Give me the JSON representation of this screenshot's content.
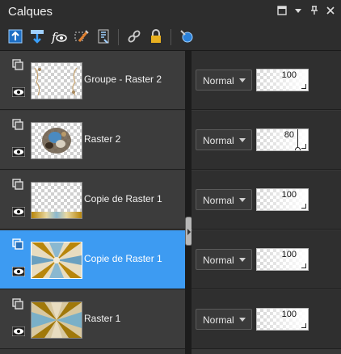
{
  "panel": {
    "title": "Calques"
  },
  "window_controls": [
    {
      "name": "restore-icon",
      "glyph": "▢"
    },
    {
      "name": "menu-arrow-icon",
      "glyph": "▾"
    },
    {
      "name": "pin-icon",
      "glyph": "⊥"
    },
    {
      "name": "close-icon",
      "glyph": "✕"
    }
  ],
  "toolbar": [
    {
      "name": "new-raster-layer-icon",
      "color": "#3aa0ff"
    },
    {
      "name": "new-vector-layer-icon",
      "color": "#3aa0ff"
    },
    {
      "name": "new-adjustment-layer-icon",
      "color": "#ffffff"
    },
    {
      "name": "edit-selection-icon",
      "color": "#e08030"
    },
    {
      "name": "layer-properties-icon",
      "color": "#9fd0ff"
    },
    {
      "name": "link-icon",
      "color": "#cccccc"
    },
    {
      "name": "lock-icon",
      "color": "#e8b020"
    },
    {
      "name": "delete-layer-icon",
      "color": "#3aa0ff"
    }
  ],
  "layers": [
    {
      "name": "Groupe - Raster 2",
      "blend": "Normal",
      "opacity": "100",
      "opacity_fraction": 1.0,
      "selected": false,
      "thumb": "transparent-ornament"
    },
    {
      "name": "Raster 2",
      "blend": "Normal",
      "opacity": "80",
      "opacity_fraction": 0.8,
      "selected": false,
      "thumb": "ornament"
    },
    {
      "name": "Copie de Raster 1",
      "blend": "Normal",
      "opacity": "100",
      "opacity_fraction": 1.0,
      "selected": false,
      "thumb": "bottom-strip"
    },
    {
      "name": "Copie de Raster 1",
      "blend": "Normal",
      "opacity": "100",
      "opacity_fraction": 1.0,
      "selected": true,
      "thumb": "rays"
    },
    {
      "name": "Raster 1",
      "blend": "Normal",
      "opacity": "100",
      "opacity_fraction": 1.0,
      "selected": false,
      "thumb": "rays"
    }
  ],
  "colors": {
    "selected_row": "#3d9bf2",
    "panel_bg": "#2d2d2d",
    "row_bg": "#3c3c3c"
  }
}
